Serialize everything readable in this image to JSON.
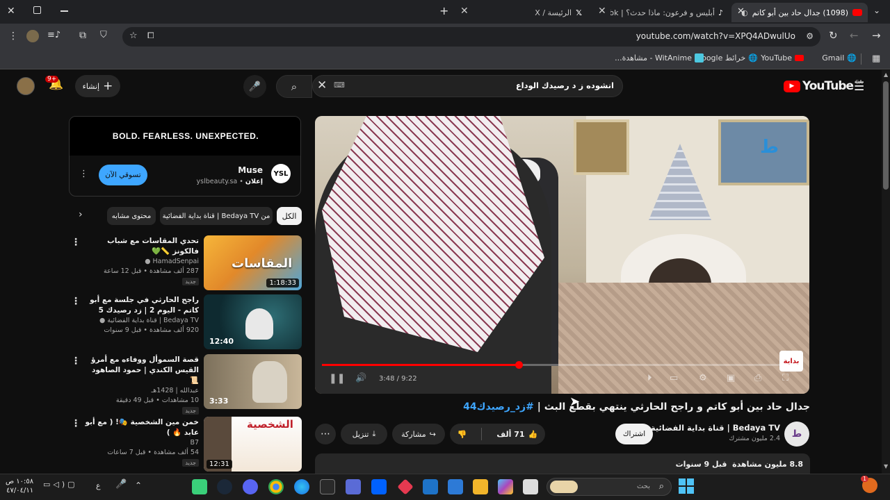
{
  "browser": {
    "tabs": [
      {
        "title": "(1098) جدال حاد بين أبو كاتم",
        "active": true
      },
      {
        "title": "أبليس و فرعون: ماذا حدث؟ | TikTok"
      },
      {
        "title": "الرئيسة / X"
      }
    ],
    "url": "youtube.com/watch?v=XPQ4ADwulUo",
    "bookmarks": [
      "Gmail",
      "YouTube",
      "خرائط Google",
      "WitAnime - مشاهدة..."
    ]
  },
  "youtube": {
    "logo": "YouTube",
    "region": "SA",
    "search_value": "انشوده ز د رصيدك الوداع",
    "create_label": "إنشاء",
    "notif_count": "9+"
  },
  "ad": {
    "banner": "BOLD. FEARLESS. UNEXPECTED.",
    "title": "Muse",
    "label": "إعلان",
    "domain": "yslbeauty.sa",
    "cta": "تسوقي الآن"
  },
  "chips": [
    "الكل",
    "من Bedaya TV | قناة بداية الفضائية",
    "محتوى مشابه"
  ],
  "related": [
    {
      "title": "تحدي المقاسات مع شباب فالكونز 📏💚",
      "channel": "HamadSenpai",
      "views": "287 ألف مشاهدة",
      "age": "قبل 12 ساعة",
      "badge": "جديد",
      "duration": "1:18:33"
    },
    {
      "title": "راجح الحارثي في جلسة مع أبو كاتم - اليوم 2 | زد رصيدك 5",
      "channel": "Bedaya TV | قناة بداية الفضائية",
      "views": "920 ألف مشاهدة",
      "age": "قبل 9 سنوات",
      "badge": "",
      "duration": "12:40"
    },
    {
      "title": "قصة السموأل ووفاءه مع أمرؤ القيس الكندي | حمود الصاهود 📜",
      "channel": "عبدالله | 1428هـ",
      "views": "10 مشاهدات",
      "age": "قبل 49 دقيقة",
      "badge": "جديد",
      "duration": "3:33"
    },
    {
      "title": "خمن مين الشخصية 🎭! ( مع أبو عابد 🔥 )",
      "channel": "B7",
      "views": "54 ألف مشاهدة",
      "age": "قبل 7 ساعات",
      "badge": "جديد",
      "duration": "12:31"
    }
  ],
  "video": {
    "title": "جدال حاد بين أبو كاتم و راجح الحارثي ينتهي بقطع البث |",
    "hashtag": "#زد_رصيدك44",
    "time": "3:48 / 9:22",
    "progress": 0.41,
    "channel": "Bedaya TV | قناة بداية الفضائية",
    "subscribers": "2.4 مليون مشترك",
    "subscribe": "اشتراك",
    "likes": "71 ألف",
    "share": "مشاركة",
    "download": "تنزيل",
    "views": "8.8 مليون مشاهدة",
    "age": "قبل 9 سنوات"
  },
  "taskbar": {
    "search_placeholder": "بحث",
    "time": "١٠:٥٨ ص",
    "date": "٤٧/٠٤/١١",
    "lang": "ع",
    "notif": "1"
  },
  "colors": {
    "youtube_red": "#ff0000",
    "link_blue": "#3ea6ff",
    "bg": "#0f0f0f"
  }
}
